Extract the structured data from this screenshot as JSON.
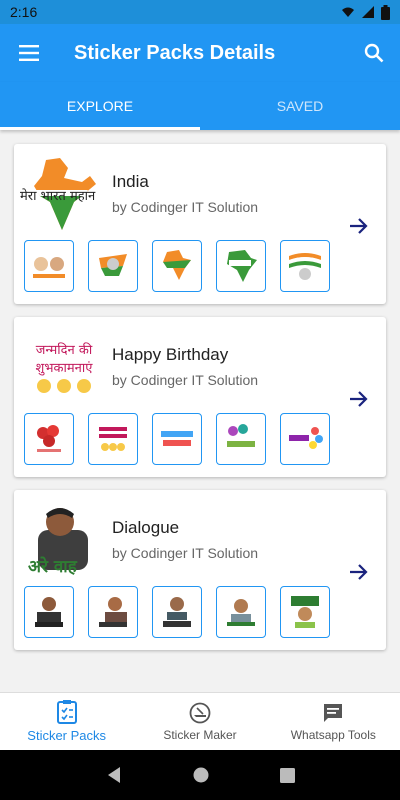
{
  "status": {
    "time": "2:16"
  },
  "appbar": {
    "title": "Sticker Packs Details"
  },
  "tabs": [
    {
      "label": "EXPLORE",
      "active": true
    },
    {
      "label": "SAVED",
      "active": false
    }
  ],
  "packs": [
    {
      "name": "India",
      "author": "by Codinger IT Solution",
      "logo_text": "मेरा भारत महान"
    },
    {
      "name": "Happy Birthday",
      "author": "by Codinger IT Solution",
      "logo_text_1": "जन्मदिन की",
      "logo_text_2": "शुभकामनाएं"
    },
    {
      "name": "Dialogue",
      "author": "by Codinger IT Solution",
      "logo_text": "अरे वाह"
    }
  ],
  "bottomnav": [
    {
      "label": "Sticker Packs",
      "icon": "clipboard-list-icon",
      "active": true
    },
    {
      "label": "Sticker Maker",
      "icon": "sticker-icon",
      "active": false
    },
    {
      "label": "Whatsapp Tools",
      "icon": "chat-icon",
      "active": false
    }
  ],
  "colors": {
    "primary": "#2196f3",
    "status": "#1e8fd9",
    "accent": "#1e88e5",
    "arrow": "#1a237e"
  }
}
